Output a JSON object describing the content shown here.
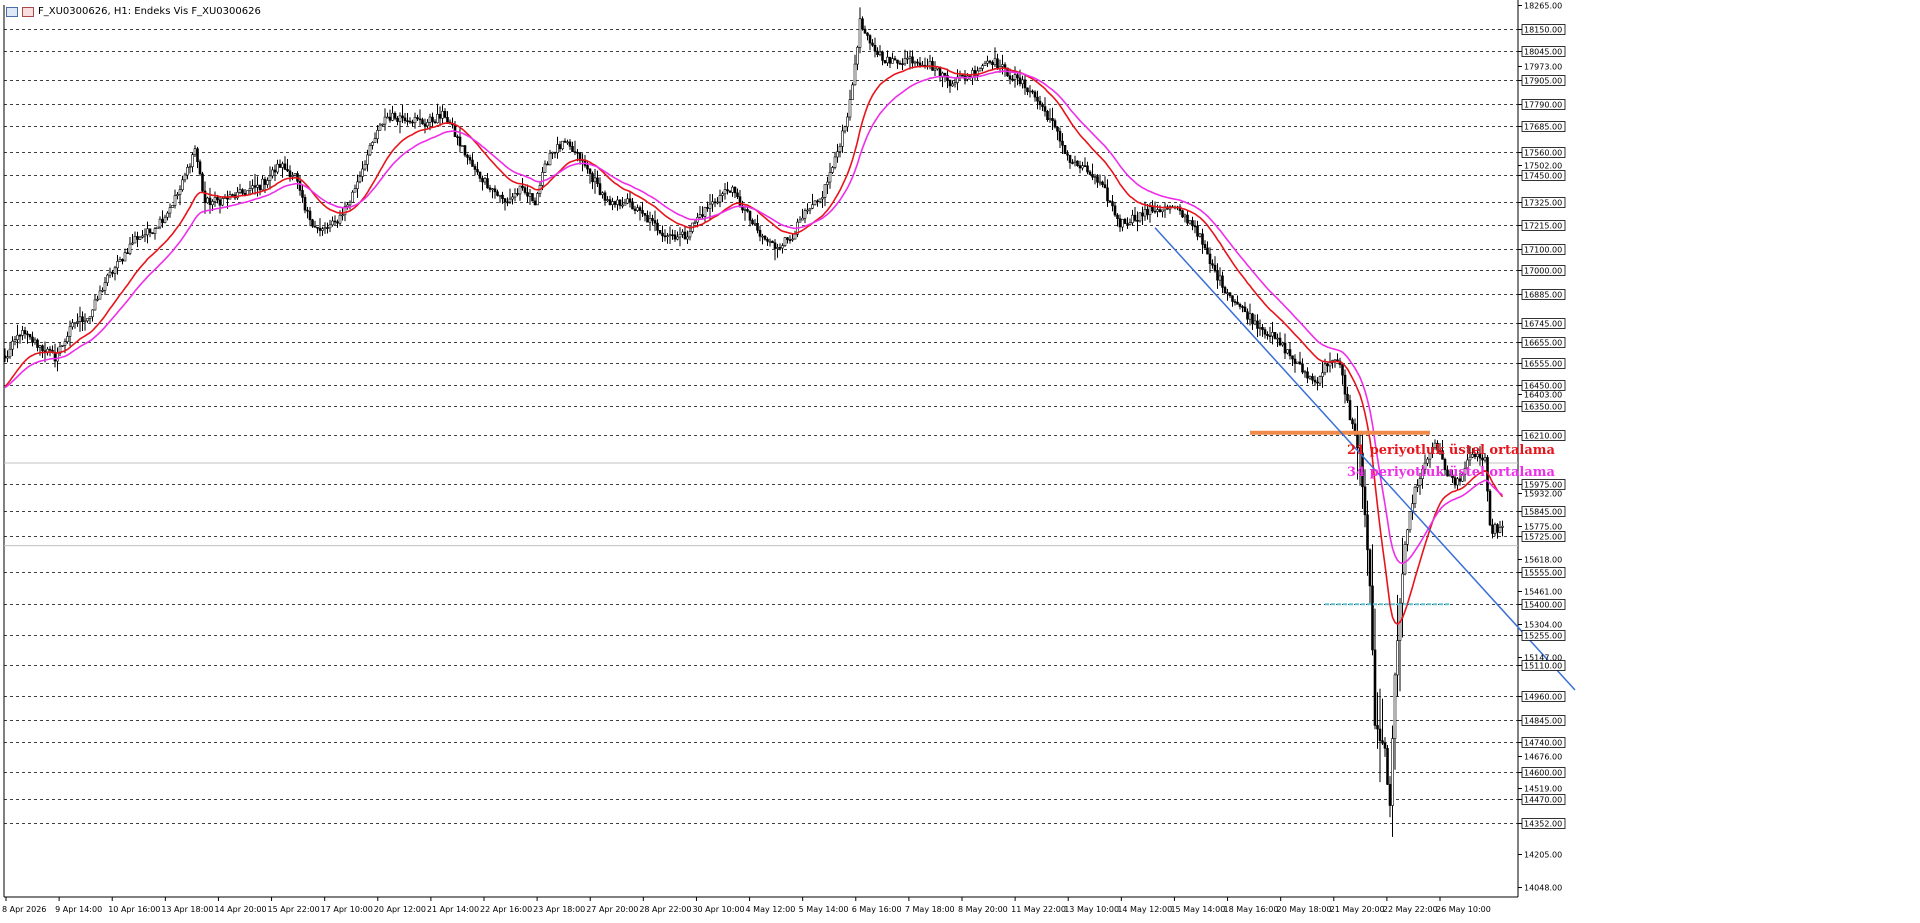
{
  "window": {
    "title": "F_XU0300626, H1:  Endeks Vis F_XU0300626"
  },
  "annotations": {
    "ema21_label": "21 periyotluk üstel ortalama",
    "ema34_label": "34 periyotluk üstel ortalama"
  },
  "colors": {
    "ema21": "#e8141c",
    "ema34": "#ee2ee8",
    "trendline": "#3a6fd8",
    "resistance": "#f08a4b",
    "support": "#5fc4d6",
    "candle": "#000000",
    "grid": "#000000",
    "price_line": "#c0c0c0"
  },
  "chart_data": {
    "type": "candlestick",
    "symbol": "F_XU0300626",
    "timeframe": "H1",
    "ylim": [
      14000,
      18265
    ],
    "grid": true,
    "y_tick_labels": [
      "18265.00",
      "18150.00",
      "18045.00",
      "17973.00",
      "17905.00",
      "17790.00",
      "17685.00",
      "17560.00",
      "17502.00",
      "17450.00",
      "17325.00",
      "17215.00",
      "17100.00",
      "17000.00",
      "16885.00",
      "16745.00",
      "16655.00",
      "16555.00",
      "16450.00",
      "16403.00",
      "16350.00",
      "16210.00",
      "15975.00",
      "15932.00",
      "15845.00",
      "15775.00",
      "15725.00",
      "15618.00",
      "15555.00",
      "15461.00",
      "15400.00",
      "15304.00",
      "15255.00",
      "15147.00",
      "15110.00",
      "14960.00",
      "14845.00",
      "14740.00",
      "14676.00",
      "14600.00",
      "14519.00",
      "14470.00",
      "14352.00",
      "14205.00",
      "14048.00"
    ],
    "x_tick_labels": [
      "8 Apr 2026",
      "9 Apr 14:00",
      "10 Apr 16:00",
      "13 Apr 18:00",
      "14 Apr 20:00",
      "15 Apr 22:00",
      "17 Apr 10:00",
      "20 Apr 12:00",
      "21 Apr 14:00",
      "22 Apr 16:00",
      "23 Apr 18:00",
      "27 Apr 20:00",
      "28 Apr 22:00",
      "30 Apr 10:00",
      "4 May 12:00",
      "5 May 14:00",
      "6 May 16:00",
      "7 May 18:00",
      "8 May 20:00",
      "11 May 22:00",
      "13 May 10:00",
      "14 May 12:00",
      "15 May 14:00",
      "18 May 16:00",
      "20 May 18:00",
      "21 May 20:00",
      "22 May 22:00",
      "26 May 10:00"
    ],
    "price_anchors": [
      [
        0,
        16570
      ],
      [
        6,
        16700
      ],
      [
        12,
        16650
      ],
      [
        20,
        16580
      ],
      [
        28,
        16750
      ],
      [
        34,
        16780
      ],
      [
        40,
        16940
      ],
      [
        46,
        17040
      ],
      [
        52,
        17150
      ],
      [
        58,
        17180
      ],
      [
        64,
        17260
      ],
      [
        70,
        17380
      ],
      [
        76,
        17580
      ],
      [
        80,
        17320
      ],
      [
        86,
        17330
      ],
      [
        94,
        17360
      ],
      [
        102,
        17400
      ],
      [
        110,
        17500
      ],
      [
        116,
        17450
      ],
      [
        120,
        17280
      ],
      [
        126,
        17180
      ],
      [
        132,
        17220
      ],
      [
        138,
        17330
      ],
      [
        144,
        17520
      ],
      [
        152,
        17730
      ],
      [
        160,
        17730
      ],
      [
        168,
        17700
      ],
      [
        176,
        17740
      ],
      [
        182,
        17600
      ],
      [
        188,
        17470
      ],
      [
        194,
        17400
      ],
      [
        200,
        17320
      ],
      [
        206,
        17380
      ],
      [
        212,
        17330
      ],
      [
        218,
        17560
      ],
      [
        224,
        17600
      ],
      [
        230,
        17530
      ],
      [
        236,
        17420
      ],
      [
        242,
        17300
      ],
      [
        248,
        17330
      ],
      [
        256,
        17250
      ],
      [
        264,
        17170
      ],
      [
        272,
        17160
      ],
      [
        278,
        17260
      ],
      [
        284,
        17330
      ],
      [
        290,
        17390
      ],
      [
        296,
        17280
      ],
      [
        302,
        17160
      ],
      [
        308,
        17110
      ],
      [
        314,
        17150
      ],
      [
        320,
        17260
      ],
      [
        326,
        17330
      ],
      [
        332,
        17520
      ],
      [
        338,
        17790
      ],
      [
        342,
        18180
      ],
      [
        346,
        18070
      ],
      [
        354,
        17990
      ],
      [
        362,
        18010
      ],
      [
        370,
        17980
      ],
      [
        378,
        17900
      ],
      [
        386,
        17930
      ],
      [
        394,
        18010
      ],
      [
        402,
        17930
      ],
      [
        410,
        17860
      ],
      [
        418,
        17720
      ],
      [
        426,
        17520
      ],
      [
        434,
        17460
      ],
      [
        440,
        17370
      ],
      [
        446,
        17220
      ],
      [
        452,
        17250
      ],
      [
        460,
        17290
      ],
      [
        468,
        17290
      ],
      [
        476,
        17210
      ],
      [
        482,
        17030
      ],
      [
        488,
        16910
      ],
      [
        494,
        16820
      ],
      [
        500,
        16750
      ],
      [
        506,
        16690
      ],
      [
        512,
        16620
      ],
      [
        518,
        16530
      ],
      [
        524,
        16460
      ],
      [
        530,
        16570
      ],
      [
        534,
        16540
      ],
      [
        538,
        16300
      ],
      [
        542,
        16120
      ],
      [
        546,
        15500
      ],
      [
        548,
        14830
      ],
      [
        550,
        14740
      ],
      [
        552,
        14700
      ],
      [
        554,
        14420
      ],
      [
        556,
        15050
      ],
      [
        558,
        15420
      ],
      [
        560,
        15700
      ],
      [
        564,
        15950
      ],
      [
        568,
        16070
      ],
      [
        572,
        16180
      ],
      [
        576,
        16050
      ],
      [
        580,
        15970
      ],
      [
        584,
        16050
      ],
      [
        588,
        16120
      ],
      [
        592,
        16080
      ],
      [
        594,
        15760
      ]
    ],
    "series": [
      {
        "name": "21 periyotluk üstel ortalama",
        "type": "ema",
        "period": 21
      },
      {
        "name": "34 periyotluk üstel ortalama",
        "type": "ema",
        "period": 34
      }
    ],
    "levels": {
      "resistance": 16220,
      "support": 15400,
      "price_line_upper": 16075,
      "price_line_lower": 15680
    },
    "trendline": {
      "from": [
        460,
        17200
      ],
      "to": [
        628,
        14990
      ]
    }
  }
}
